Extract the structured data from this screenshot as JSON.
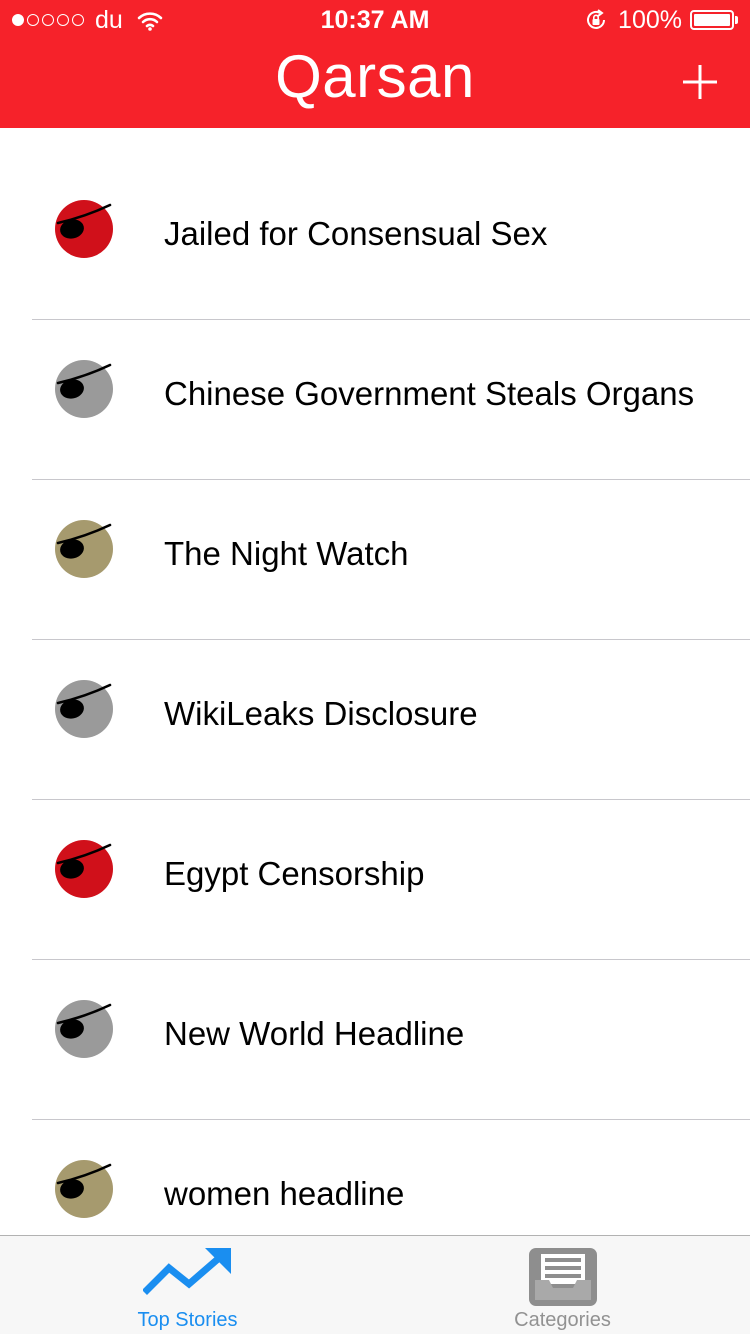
{
  "status_bar": {
    "signal_filled": 1,
    "signal_total": 5,
    "carrier": "du",
    "time": "10:37 AM",
    "battery_percent": "100%",
    "icons": [
      "wifi-icon",
      "rotation-lock-icon",
      "battery-icon"
    ]
  },
  "nav": {
    "title": "Qarsan",
    "add_icon": "plus-icon"
  },
  "colors": {
    "header": "#f6222a",
    "tab_active": "#1a8ef0",
    "tab_inactive": "#929292",
    "badge_red": "#d0101a",
    "badge_gray": "#9a9a9a",
    "badge_khaki": "#a69a6e"
  },
  "stories": [
    {
      "title": "Jailed for Consensual Sex",
      "badge_color": "#d0101a",
      "icon": "pirate-eyepatch-icon"
    },
    {
      "title": "Chinese Government Steals Organs",
      "badge_color": "#9a9a9a",
      "icon": "pirate-eyepatch-icon"
    },
    {
      "title": "The Night Watch",
      "badge_color": "#a69a6e",
      "icon": "pirate-eyepatch-icon"
    },
    {
      "title": "WikiLeaks Disclosure",
      "badge_color": "#9a9a9a",
      "icon": "pirate-eyepatch-icon"
    },
    {
      "title": "Egypt Censorship",
      "badge_color": "#d0101a",
      "icon": "pirate-eyepatch-icon"
    },
    {
      "title": "New World Headline",
      "badge_color": "#9a9a9a",
      "icon": "pirate-eyepatch-icon"
    },
    {
      "title": "women headline",
      "badge_color": "#a69a6e",
      "icon": "pirate-eyepatch-icon"
    }
  ],
  "tabs": [
    {
      "label": "Top Stories",
      "icon": "trending-up-icon",
      "active": true
    },
    {
      "label": "Categories",
      "icon": "inbox-tray-icon",
      "active": false
    }
  ]
}
